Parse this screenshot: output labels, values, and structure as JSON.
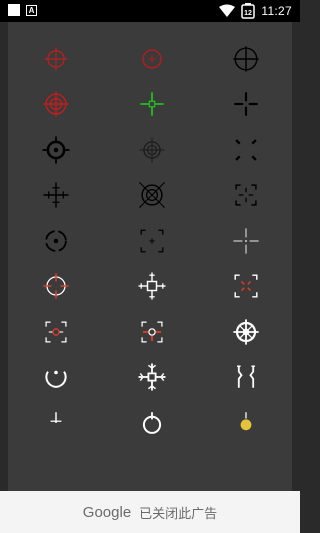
{
  "status_bar": {
    "time": "11:27",
    "notifications": [
      "square-icon",
      "a-badge-icon"
    ],
    "a_badge_text": "A",
    "battery_level_text": "12",
    "indicators": [
      "wifi-icon",
      "battery-icon"
    ]
  },
  "crosshair_grid": {
    "accent_colors": {
      "red": "#d11a1a",
      "green": "#22cc22",
      "black": "#000000",
      "white": "#ffffff"
    },
    "items": [
      "crosshair-red-thin-circle-icon",
      "crosshair-red-circle-icon",
      "crosshair-black-circle-icon",
      "crosshair-red-double-circle-icon",
      "crosshair-green-cross-icon",
      "crosshair-black-cross-icon",
      "crosshair-black-bold-ring-icon",
      "crosshair-dark-ring-icon",
      "crosshair-black-corner-dots-icon",
      "crosshair-black-tactical-cross-icon",
      "crosshair-black-scope-icon",
      "crosshair-black-dashed-box-icon",
      "crosshair-black-dotted-ring-icon",
      "crosshair-black-bracket-icon",
      "crosshair-white-thin-cross-icon",
      "crosshair-red-white-circle-icon",
      "crosshair-white-snow-icon",
      "crosshair-red-white-bracket-icon",
      "crosshair-red-white-box-icon",
      "crosshair-red-white-dot-box-icon",
      "crosshair-white-gear-icon",
      "crosshair-white-arc-icon",
      "crosshair-white-snowflake-icon",
      "crosshair-white-bracket-pair-icon",
      "crosshair-white-partial-a-icon",
      "crosshair-white-partial-b-icon",
      "crosshair-yellow-partial-icon"
    ]
  },
  "ad_bar": {
    "brand": "Google",
    "message": "已关闭此广告"
  }
}
